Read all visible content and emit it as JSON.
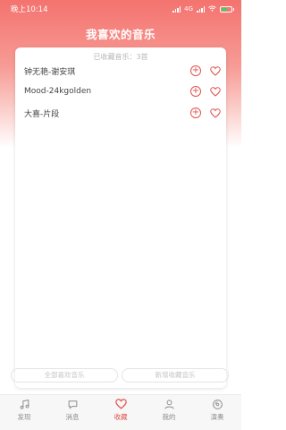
{
  "status": {
    "time": "晚上10:14",
    "network": "4G",
    "battery_level": 0.6
  },
  "header": {
    "title": "我喜欢的音乐"
  },
  "card": {
    "count_text": "已收藏音乐：3首",
    "songs": [
      {
        "name": "钟无艳-谢安琪"
      },
      {
        "name": "Mood-24kgolden"
      },
      {
        "name": "大喜-片段"
      }
    ],
    "delete_button": "全部喜欢音乐",
    "add_button": "新增收藏音乐"
  },
  "tabs": [
    {
      "label": "发现",
      "icon": "music-note-icon",
      "active": false
    },
    {
      "label": "消息",
      "icon": "chat-bubble-icon",
      "active": false
    },
    {
      "label": "收藏",
      "icon": "heart-icon",
      "active": true
    },
    {
      "label": "我的",
      "icon": "user-icon",
      "active": false
    },
    {
      "label": "演奏",
      "icon": "disc-icon",
      "active": false
    }
  ],
  "colors": {
    "accent": "#e0524c",
    "header_gradient_top": "#f4736f"
  }
}
